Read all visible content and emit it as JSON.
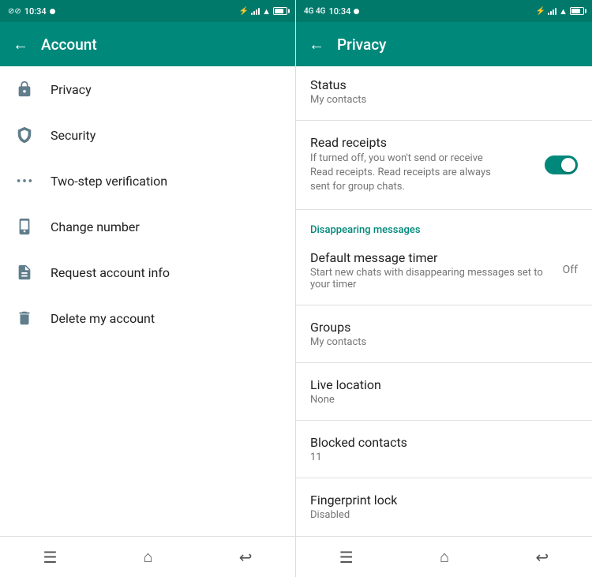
{
  "account_panel": {
    "status_bar": {
      "time": "10:34",
      "signal_indicator": "●",
      "network_type": "⊘"
    },
    "header": {
      "back_label": "←",
      "title": "Account"
    },
    "menu_items": [
      {
        "id": "privacy",
        "icon": "🔒",
        "label": "Privacy"
      },
      {
        "id": "security",
        "icon": "🛡",
        "label": "Security"
      },
      {
        "id": "two-step",
        "icon": "···",
        "label": "Two-step verification"
      },
      {
        "id": "change-number",
        "icon": "📋",
        "label": "Change number"
      },
      {
        "id": "request-info",
        "icon": "📄",
        "label": "Request account info"
      },
      {
        "id": "delete-account",
        "icon": "🗑",
        "label": "Delete my account"
      }
    ],
    "nav": {
      "menu_icon": "☰",
      "home_icon": "⌂",
      "back_icon": "↩"
    }
  },
  "privacy_panel": {
    "status_bar": {
      "time": "10:34",
      "signal_indicator": "●"
    },
    "header": {
      "back_label": "←",
      "title": "Privacy"
    },
    "items": [
      {
        "id": "status",
        "title": "Status",
        "sub": "My contacts",
        "type": "nav",
        "value": ""
      },
      {
        "id": "read-receipts",
        "title": "Read receipts",
        "sub": "If turned off, you won't send or receive Read receipts. Read receipts are always sent for group chats.",
        "type": "toggle",
        "toggle_on": true
      },
      {
        "id": "section-disappearing",
        "type": "section",
        "label": "Disappearing messages"
      },
      {
        "id": "default-timer",
        "title": "Default message timer",
        "sub": "Start new chats with disappearing messages set to your timer",
        "type": "value",
        "value": "Off"
      },
      {
        "id": "groups",
        "title": "Groups",
        "sub": "My contacts",
        "type": "nav",
        "value": ""
      },
      {
        "id": "live-location",
        "title": "Live location",
        "sub": "None",
        "type": "nav",
        "value": ""
      },
      {
        "id": "blocked-contacts",
        "title": "Blocked contacts",
        "sub": "11",
        "type": "nav",
        "value": ""
      },
      {
        "id": "fingerprint-lock",
        "title": "Fingerprint lock",
        "sub": "Disabled",
        "type": "nav",
        "value": ""
      }
    ],
    "nav": {
      "menu_icon": "☰",
      "home_icon": "⌂",
      "back_icon": "↩"
    }
  }
}
